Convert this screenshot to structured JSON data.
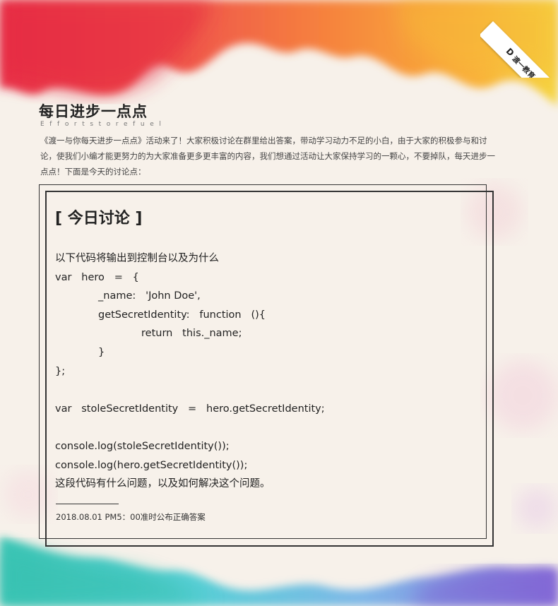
{
  "brand": {
    "mark": "D",
    "name": "渡一教育"
  },
  "header": {
    "title": "每日进步一点点",
    "subtitle": "Effortstorefuel",
    "intro": "《渡一与你每天进步一点点》活动来了！大家积极讨论在群里给出答案，带动学习动力不足的小白，由于大家的积极参与和讨论，使我们小编才能更努力的为大家准备更多更丰富的内容，我们想通过活动让大家保持学习的一颗心，不要掉队，每天进步一点点！下面是今天的讨论点："
  },
  "discussion": {
    "heading": "[ 今日讨论 ]",
    "lines": [
      "以下代码将输出到控制台以及为什么",
      "var   hero   =   {",
      "_name:   'John Doe',",
      "getSecretIdentity:   function   (){",
      "return   this._name;",
      "}",
      "};",
      "",
      "var   stoleSecretIdentity   =   hero.getSecretIdentity;",
      "",
      "console.log(stoleSecretIdentity());",
      "console.log(hero.getSecretIdentity());",
      "这段代码有什么问题，以及如何解决这个问题。"
    ],
    "answer_time": "2018.08.01  PM5：00准时公布正确答案"
  }
}
